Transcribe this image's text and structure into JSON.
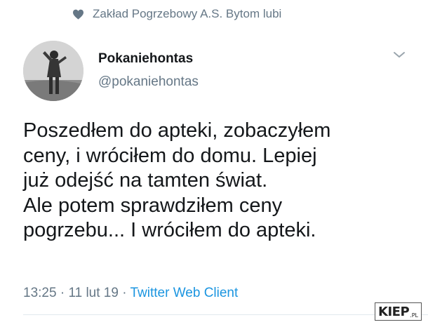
{
  "liked_by": {
    "text": "Zakład Pogrzebowy A.S. Bytom lubi",
    "icon": "heart-icon"
  },
  "author": {
    "display_name": "Pokaniehontas",
    "handle": "@pokaniehontas"
  },
  "tweet": {
    "lines": [
      "Poszedłem do apteki, zobaczyłem",
      "ceny, i wróciłem do domu. Lepiej",
      "już odejść na tamten świat.",
      "Ale potem sprawdziłem ceny",
      "pogrzebu... I wróciłem do apteki."
    ],
    "time": "13:25",
    "date": "11 lut 19",
    "separator": "·",
    "client": "Twitter Web Client"
  },
  "watermark": {
    "main": "KIEP",
    "tld": ".PL"
  },
  "colors": {
    "secondary_text": "#657786",
    "link": "#1b95e0",
    "text": "#14171a"
  }
}
